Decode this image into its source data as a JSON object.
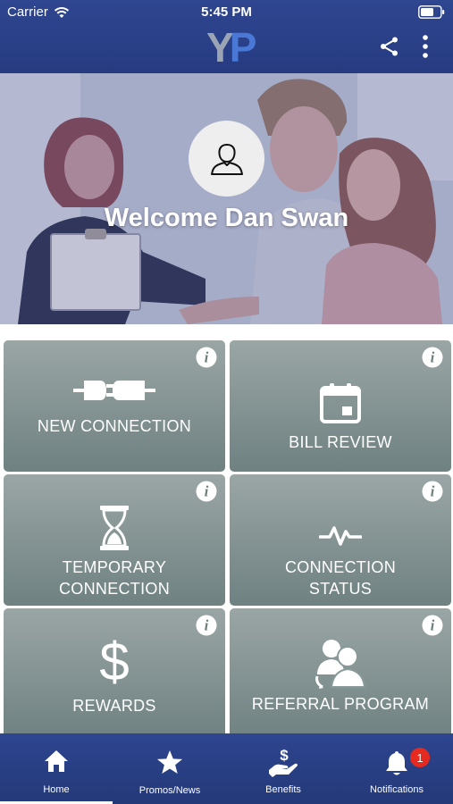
{
  "status_bar": {
    "carrier": "Carrier",
    "time": "5:45 PM"
  },
  "header": {
    "logo_y": "Y",
    "logo_p": "P"
  },
  "hero": {
    "welcome": "Welcome Dan Swan"
  },
  "tiles": [
    {
      "label": "NEW CONNECTION",
      "icon": "plug-icon"
    },
    {
      "label": "BILL REVIEW",
      "icon": "calendar-icon"
    },
    {
      "label_line1": "TEMPORARY",
      "label_line2": "CONNECTION",
      "icon": "hourglass-icon"
    },
    {
      "label_line1": "CONNECTION",
      "label_line2": "STATUS",
      "icon": "pulse-icon"
    },
    {
      "label": "REWARDS",
      "icon": "dollar-icon"
    },
    {
      "label": "REFERRAL PROGRAM",
      "icon": "referral-users-icon"
    }
  ],
  "tabbar": {
    "tabs": [
      {
        "label": "Home",
        "icon": "home-icon",
        "active": true
      },
      {
        "label": "Promos/News",
        "icon": "star-icon"
      },
      {
        "label": "Benefits",
        "icon": "benefits-hand-icon"
      },
      {
        "label": "Notifications",
        "icon": "bell-icon"
      }
    ],
    "notifications_badge": "1"
  },
  "colors": {
    "header_bg": "#2f4690",
    "tile_top": "#9aa6a5",
    "tile_bottom": "#6f8181",
    "badge": "#e52a1f"
  }
}
